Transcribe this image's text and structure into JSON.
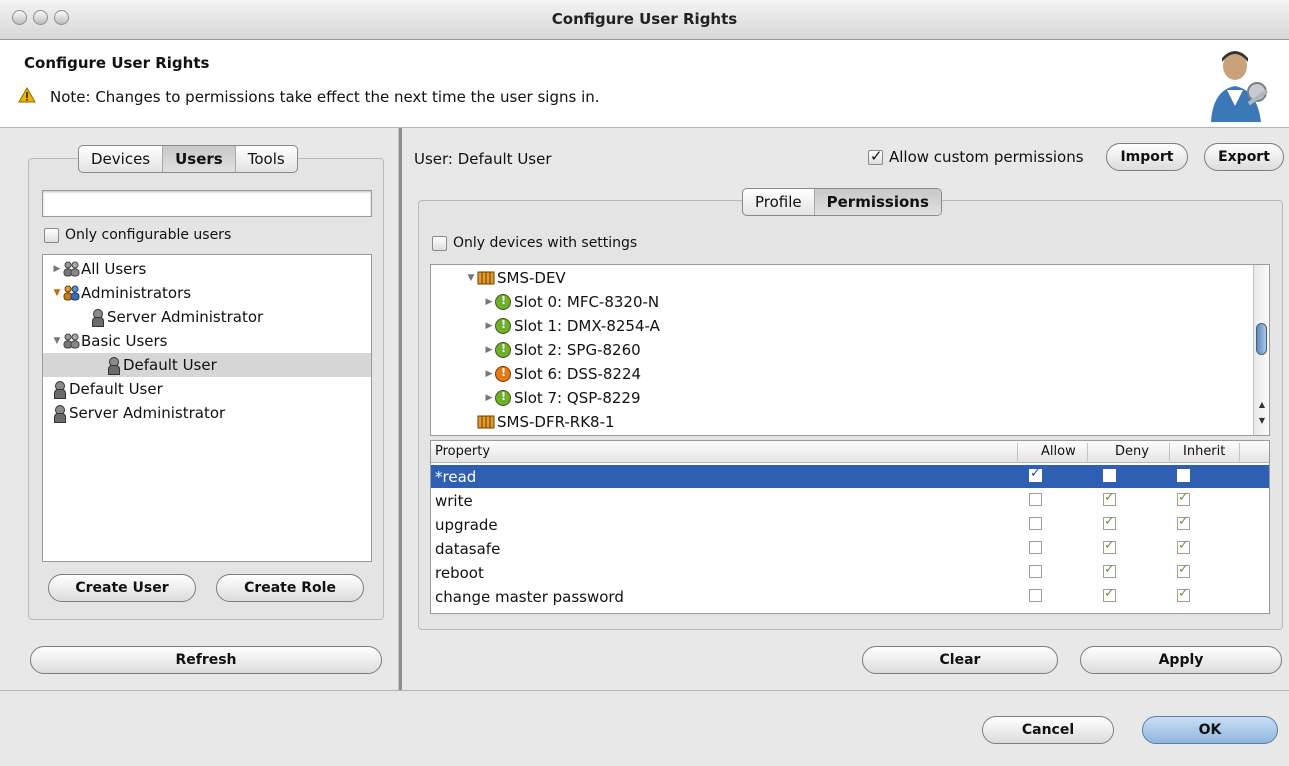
{
  "window": {
    "title": "Configure User Rights"
  },
  "header": {
    "title": "Configure User Rights",
    "note": "Note: Changes to permissions take effect the next time the user signs in."
  },
  "left": {
    "tabs": [
      "Devices",
      "Users",
      "Tools"
    ],
    "active_tab": "Users",
    "search_value": "",
    "only_configurable_label": "Only configurable users",
    "only_configurable_checked": false,
    "tree": [
      {
        "label": "All Users",
        "type": "group",
        "level": 0,
        "expanded": false
      },
      {
        "label": "Administrators",
        "type": "group",
        "level": 0,
        "expanded": true
      },
      {
        "label": "Server Administrator",
        "type": "user",
        "level": 1
      },
      {
        "label": "Basic Users",
        "type": "group",
        "level": 0,
        "expanded": true
      },
      {
        "label": "Default User",
        "type": "user",
        "level": 1,
        "selected": true
      },
      {
        "label": "Default User",
        "type": "user",
        "level": 0
      },
      {
        "label": "Server Administrator",
        "type": "user",
        "level": 0
      }
    ],
    "create_user": "Create User",
    "create_role": "Create Role",
    "refresh": "Refresh"
  },
  "right": {
    "user_label": "User: Default User",
    "allow_custom_label": "Allow custom permissions",
    "allow_custom_checked": true,
    "import": "Import",
    "export": "Export",
    "tabs": [
      "Profile",
      "Permissions"
    ],
    "active_tab": "Permissions",
    "only_devices_label": "Only devices with settings",
    "only_devices_checked": false,
    "devices": [
      {
        "label": "SMS-DEV",
        "type": "chassis",
        "level": 0,
        "expanded": true
      },
      {
        "label": "Slot 0: MFC-8320-N",
        "type": "slot",
        "level": 1,
        "color": "#6fae2c"
      },
      {
        "label": "Slot 1: DMX-8254-A",
        "type": "slot",
        "level": 1,
        "color": "#6fae2c"
      },
      {
        "label": "Slot 2: SPG-8260",
        "type": "slot",
        "level": 1,
        "color": "#6fae2c"
      },
      {
        "label": "Slot 6: DSS-8224",
        "type": "slot",
        "level": 1,
        "color": "#e07b18"
      },
      {
        "label": "Slot 7: QSP-8229",
        "type": "slot",
        "level": 1,
        "color": "#6fae2c"
      },
      {
        "label": "SMS-DFR-RK8-1",
        "type": "chassis",
        "level": 0
      }
    ],
    "columns": [
      "Property",
      "Allow",
      "Deny",
      "Inherit"
    ],
    "properties": [
      {
        "name": "*read",
        "allow": true,
        "deny": false,
        "inherit": false,
        "selected": true
      },
      {
        "name": "write",
        "allow": false,
        "deny": true,
        "inherit": true
      },
      {
        "name": "upgrade",
        "allow": false,
        "deny": true,
        "inherit": true
      },
      {
        "name": "datasafe",
        "allow": false,
        "deny": true,
        "inherit": true
      },
      {
        "name": "reboot",
        "allow": false,
        "deny": true,
        "inherit": true
      },
      {
        "name": "change master password",
        "allow": false,
        "deny": true,
        "inherit": true
      }
    ],
    "clear": "Clear",
    "apply": "Apply"
  },
  "footer": {
    "cancel": "Cancel",
    "ok": "OK"
  },
  "colors": {
    "selection": "#2f5fb3",
    "accent_button": "#8fb6df",
    "warning": "#f0b400"
  }
}
